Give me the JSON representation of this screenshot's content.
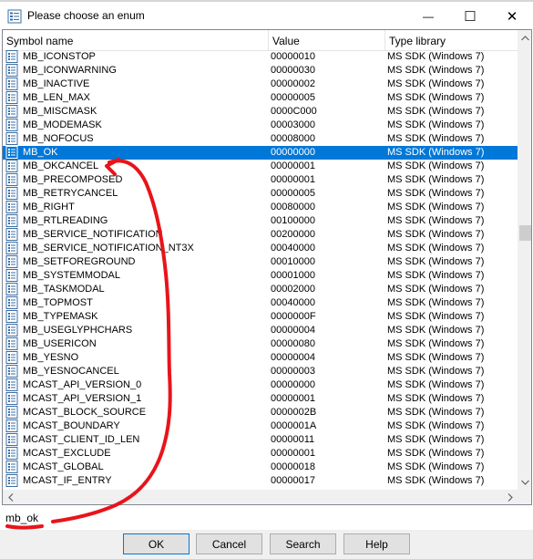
{
  "window": {
    "title": "Please choose an enum",
    "minimize_glyph": "—",
    "maximize_glyph": "☐",
    "close_glyph": "✕"
  },
  "columns": [
    "Symbol name",
    "Value",
    "Type library"
  ],
  "rows": [
    {
      "name": "MB_ICONSTOP",
      "value": "00000010",
      "lib": "MS SDK (Windows 7)"
    },
    {
      "name": "MB_ICONWARNING",
      "value": "00000030",
      "lib": "MS SDK (Windows 7)"
    },
    {
      "name": "MB_INACTIVE",
      "value": "00000002",
      "lib": "MS SDK (Windows 7)"
    },
    {
      "name": "MB_LEN_MAX",
      "value": "00000005",
      "lib": "MS SDK (Windows 7)"
    },
    {
      "name": "MB_MISCMASK",
      "value": "0000C000",
      "lib": "MS SDK (Windows 7)"
    },
    {
      "name": "MB_MODEMASK",
      "value": "00003000",
      "lib": "MS SDK (Windows 7)"
    },
    {
      "name": "MB_NOFOCUS",
      "value": "00008000",
      "lib": "MS SDK (Windows 7)"
    },
    {
      "name": "MB_OK",
      "value": "00000000",
      "lib": "MS SDK (Windows 7)",
      "selected": true
    },
    {
      "name": "MB_OKCANCEL",
      "value": "00000001",
      "lib": "MS SDK (Windows 7)"
    },
    {
      "name": "MB_PRECOMPOSED",
      "value": "00000001",
      "lib": "MS SDK (Windows 7)"
    },
    {
      "name": "MB_RETRYCANCEL",
      "value": "00000005",
      "lib": "MS SDK (Windows 7)"
    },
    {
      "name": "MB_RIGHT",
      "value": "00080000",
      "lib": "MS SDK (Windows 7)"
    },
    {
      "name": "MB_RTLREADING",
      "value": "00100000",
      "lib": "MS SDK (Windows 7)"
    },
    {
      "name": "MB_SERVICE_NOTIFICATION",
      "value": "00200000",
      "lib": "MS SDK (Windows 7)"
    },
    {
      "name": "MB_SERVICE_NOTIFICATION_NT3X",
      "value": "00040000",
      "lib": "MS SDK (Windows 7)"
    },
    {
      "name": "MB_SETFOREGROUND",
      "value": "00010000",
      "lib": "MS SDK (Windows 7)"
    },
    {
      "name": "MB_SYSTEMMODAL",
      "value": "00001000",
      "lib": "MS SDK (Windows 7)"
    },
    {
      "name": "MB_TASKMODAL",
      "value": "00002000",
      "lib": "MS SDK (Windows 7)"
    },
    {
      "name": "MB_TOPMOST",
      "value": "00040000",
      "lib": "MS SDK (Windows 7)"
    },
    {
      "name": "MB_TYPEMASK",
      "value": "0000000F",
      "lib": "MS SDK (Windows 7)"
    },
    {
      "name": "MB_USEGLYPHCHARS",
      "value": "00000004",
      "lib": "MS SDK (Windows 7)"
    },
    {
      "name": "MB_USERICON",
      "value": "00000080",
      "lib": "MS SDK (Windows 7)"
    },
    {
      "name": "MB_YESNO",
      "value": "00000004",
      "lib": "MS SDK (Windows 7)"
    },
    {
      "name": "MB_YESNOCANCEL",
      "value": "00000003",
      "lib": "MS SDK (Windows 7)"
    },
    {
      "name": "MCAST_API_VERSION_0",
      "value": "00000000",
      "lib": "MS SDK (Windows 7)"
    },
    {
      "name": "MCAST_API_VERSION_1",
      "value": "00000001",
      "lib": "MS SDK (Windows 7)"
    },
    {
      "name": "MCAST_BLOCK_SOURCE",
      "value": "0000002B",
      "lib": "MS SDK (Windows 7)"
    },
    {
      "name": "MCAST_BOUNDARY",
      "value": "0000001A",
      "lib": "MS SDK (Windows 7)"
    },
    {
      "name": "MCAST_CLIENT_ID_LEN",
      "value": "00000011",
      "lib": "MS SDK (Windows 7)"
    },
    {
      "name": "MCAST_EXCLUDE",
      "value": "00000001",
      "lib": "MS SDK (Windows 7)"
    },
    {
      "name": "MCAST_GLOBAL",
      "value": "00000018",
      "lib": "MS SDK (Windows 7)"
    },
    {
      "name": "MCAST_IF_ENTRY",
      "value": "00000017",
      "lib": "MS SDK (Windows 7)"
    }
  ],
  "input": {
    "value": "mb_ok"
  },
  "buttons": {
    "ok": "OK",
    "cancel": "Cancel",
    "search": "Search",
    "help": "Help"
  },
  "colors": {
    "selection": "#0078d7",
    "annotation": "#e8141b"
  }
}
